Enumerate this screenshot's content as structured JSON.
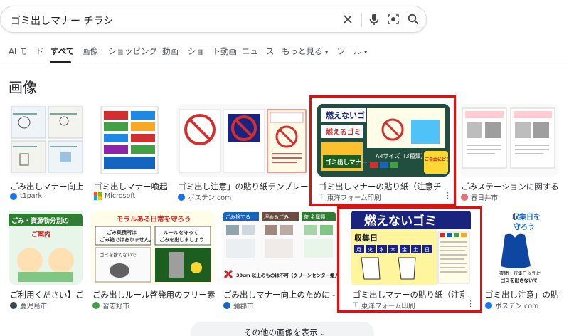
{
  "search": {
    "query": "ゴミ出しマナー チラシ"
  },
  "tabs": [
    "AI モード",
    "すべて",
    "画像",
    "ショッピング",
    "動画",
    "ショート動画",
    "ニュース",
    "もっと見る",
    "ツール"
  ],
  "section_title": "画像",
  "cards": [
    {
      "title": "ごみ出しマナー向上...",
      "source": "t1park"
    },
    {
      "title": "ゴミ出しマナー喚起...",
      "source": "Microsoft"
    },
    {
      "title": "ゴミ出し注意」の貼り紙テンプレート...",
      "source": "ポステン.com"
    },
    {
      "title": "ゴミ出しマナーの貼り紙（注意チラシ...",
      "source": "東洋フォーム印刷",
      "thumb_text": {
        "t1": "燃えないゴミ",
        "t2": "燃えるゴミ",
        "t3": "ゴミ出しマナー",
        "t4": "A4サイズ（3種類）",
        "t5": "ご自由にどうぞ"
      }
    },
    {
      "title": "ごみステーションに関する...",
      "source": "春日井市"
    },
    {
      "title": "ご利用ください】ご...",
      "source": "鹿児島市",
      "thumb_text": {
        "t1": "ごみ・資源物分別の",
        "t2": "ご案内"
      }
    },
    {
      "title": "ごみ出しルール啓発用のフリー素...",
      "source": "習志野市",
      "thumb_text": {
        "t1": "モラルある日常を守ろう",
        "t2": "ごみ集積所は",
        "t3": "ごみ箱ではありません。",
        "t4": "ルールを守って",
        "t5": "ごみを出しましょう",
        "t6": "ゴミを捨てないで"
      }
    },
    {
      "title": "ごみ出しマナー向上のために - 愛知...",
      "source": "蒲郡市",
      "thumb_text": {
        "t1": "ごみ捨てる",
        "t2": "埋めるごみ",
        "t3": "茶 金属類",
        "t4": "30cm 以上のものは不可（クリーンセンター搬入）"
      }
    },
    {
      "title": "ゴミ出しマナーの貼り紙（注意チラ...",
      "source": "東洋フォーム印刷",
      "thumb_text": {
        "t1": "燃えないゴミ",
        "t2": "収集日",
        "days": [
          "月",
          "火",
          "水",
          "木",
          "金",
          "土",
          "日"
        ]
      }
    },
    {
      "title": "ゴミ出し注意」の貼り...",
      "source": "ポステン.com",
      "thumb_text": {
        "t1": "収集日を",
        "t2": "守ろう",
        "t3": "夜間・収集日以外に",
        "t4": "ゴミを出さないで"
      }
    }
  ],
  "more_button": "その他の画像を表示",
  "colors": {
    "highlight": "#e01010",
    "accent_green": "#2e7d32"
  }
}
